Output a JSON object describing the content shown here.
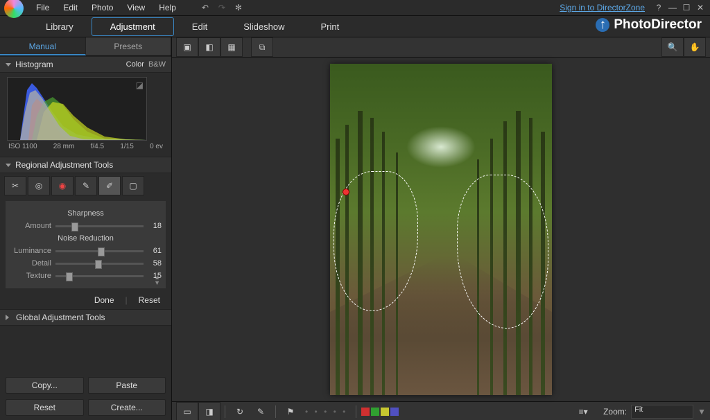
{
  "menu": {
    "items": [
      "File",
      "Edit",
      "Photo",
      "View",
      "Help"
    ]
  },
  "top_right": {
    "signin": "Sign in to DirectorZone"
  },
  "brand": {
    "name": "PhotoDirector"
  },
  "modes": {
    "items": [
      "Library",
      "Adjustment",
      "Edit",
      "Slideshow",
      "Print"
    ],
    "active": 1
  },
  "subtabs": {
    "items": [
      "Manual",
      "Presets"
    ],
    "active": 0
  },
  "panels": {
    "histogram": {
      "title": "Histogram",
      "opts": [
        "Color",
        "B&W"
      ],
      "meta": {
        "iso": "ISO 1100",
        "focal": "28 mm",
        "aperture": "f/4.5",
        "shutter": "1/15",
        "ev": "0 ev"
      }
    },
    "regional": {
      "title": "Regional Adjustment Tools",
      "sharpness": {
        "title": "Sharpness",
        "amount_label": "Amount",
        "amount": 18
      },
      "noise": {
        "title": "Noise Reduction",
        "luminance_label": "Luminance",
        "luminance": 61,
        "detail_label": "Detail",
        "detail": 58,
        "texture_label": "Texture",
        "texture": 15
      }
    },
    "global": {
      "title": "Global Adjustment Tools"
    }
  },
  "actions": {
    "done": "Done",
    "reset": "Reset",
    "copy": "Copy...",
    "paste": "Paste",
    "reset2": "Reset",
    "create": "Create..."
  },
  "bottom": {
    "zoom_label": "Zoom:",
    "zoom_value": "Fit"
  },
  "colors": [
    "#d03030",
    "#30a030",
    "#c8c830",
    "#5050c0"
  ]
}
